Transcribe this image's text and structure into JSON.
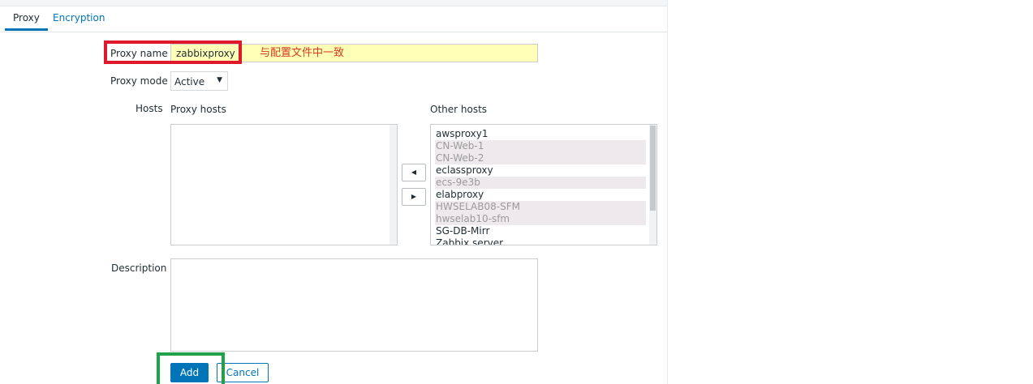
{
  "tabs": [
    {
      "label": "Proxy",
      "active": true
    },
    {
      "label": "Encryption",
      "active": false
    }
  ],
  "form": {
    "proxy_name_label": "Proxy name",
    "proxy_name_value": "zabbixproxy",
    "annotation": "与配置文件中一致",
    "proxy_mode_label": "Proxy mode",
    "proxy_mode_value": "Active",
    "hosts_label": "Hosts",
    "proxy_hosts_label": "Proxy hosts",
    "other_hosts_label": "Other hosts",
    "other_hosts": [
      {
        "name": "awsproxy1",
        "disabled": false
      },
      {
        "name": "CN-Web-1",
        "disabled": true
      },
      {
        "name": "CN-Web-2",
        "disabled": true
      },
      {
        "name": "eclassproxy",
        "disabled": false
      },
      {
        "name": "ecs-9e3b",
        "disabled": true
      },
      {
        "name": "elabproxy",
        "disabled": false
      },
      {
        "name": "HWSELAB08-SFM",
        "disabled": true
      },
      {
        "name": "hwselab10-sfm",
        "disabled": true
      },
      {
        "name": "SG-DB-Mirr",
        "disabled": false
      },
      {
        "name": "Zabbix server",
        "disabled": false
      }
    ],
    "move_left_icon": "triangle-left-icon",
    "move_right_icon": "triangle-right-icon",
    "description_label": "Description",
    "description_value": ""
  },
  "buttons": {
    "add_label": "Add",
    "cancel_label": "Cancel"
  },
  "colors": {
    "accent": "#0275b8",
    "highlight_red": "#e0182b",
    "highlight_green": "#20a348",
    "annotation_text": "#d23b1e",
    "proxy_name_bg": "#ffffb8"
  }
}
